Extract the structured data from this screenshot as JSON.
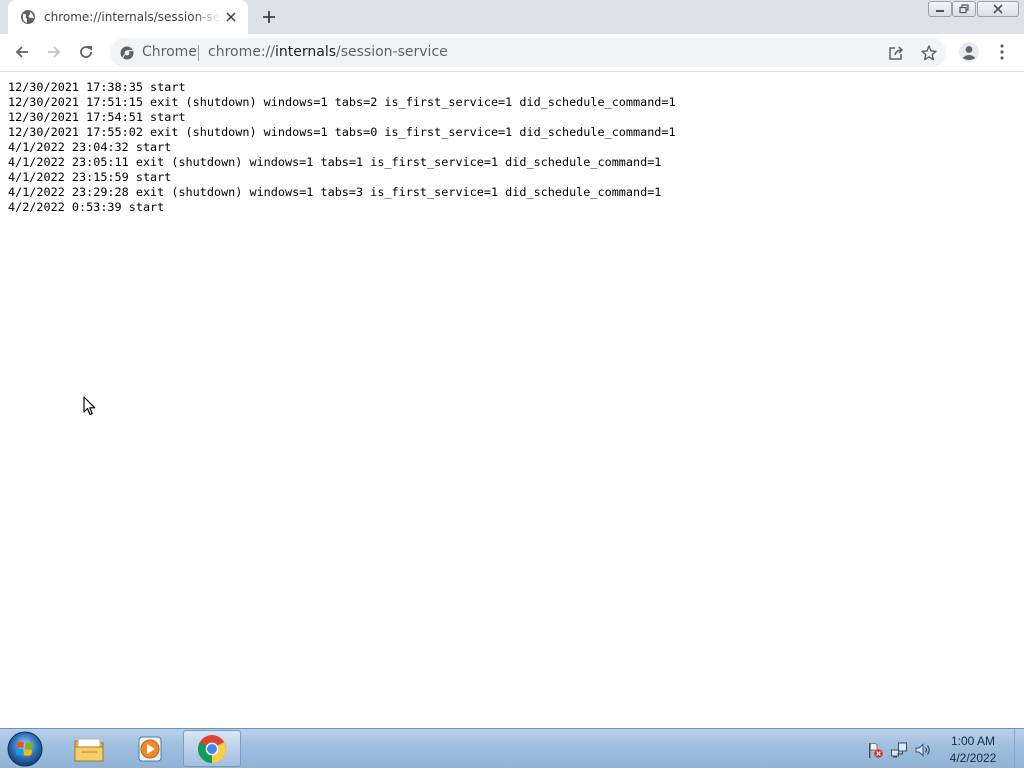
{
  "browser": {
    "tab": {
      "title": "chrome://internals/session-service",
      "favicon": "globe-icon",
      "close_icon": "close-icon"
    },
    "new_tab_icon": "plus-icon",
    "window_controls": [
      "minimize-icon",
      "restore-icon",
      "close-icon"
    ],
    "toolbar": {
      "back_icon": "back-arrow-icon",
      "forward_icon": "forward-arrow-icon",
      "reload_icon": "reload-icon",
      "profile_icon": "profile-icon",
      "menu_icon": "kebab-menu-icon"
    },
    "omnibox": {
      "site_label": "Chrome",
      "url_scheme": "chrome://",
      "url_host": "internals",
      "url_path": "/session-service",
      "share_icon": "share-icon",
      "bookmark_icon": "star-icon"
    }
  },
  "page": {
    "log_lines": [
      "12/30/2021 17:38:35 start",
      "12/30/2021 17:51:15 exit (shutdown) windows=1 tabs=2 is_first_service=1 did_schedule_command=1",
      "12/30/2021 17:54:51 start",
      "12/30/2021 17:55:02 exit (shutdown) windows=1 tabs=0 is_first_service=1 did_schedule_command=1",
      "4/1/2022 23:04:32 start",
      "4/1/2022 23:05:11 exit (shutdown) windows=1 tabs=1 is_first_service=1 did_schedule_command=1",
      "4/1/2022 23:15:59 start",
      "4/1/2022 23:29:28 exit (shutdown) windows=1 tabs=3 is_first_service=1 did_schedule_command=1",
      "4/2/2022 0:53:39 start"
    ]
  },
  "taskbar": {
    "start_icon": "windows-start-icon",
    "pinned": [
      "file-explorer-icon",
      "media-player-icon",
      "chrome-icon"
    ],
    "tray_icons": [
      "action-center-flag-icon",
      "network-icon",
      "volume-icon"
    ],
    "clock_time": "1:00 AM",
    "clock_date": "4/2/2022"
  },
  "colors": {
    "tabstrip_bg": "#dee1e6",
    "omnibox_bg": "#f1f3f4",
    "taskbar_bg": "#9fbfdf"
  }
}
